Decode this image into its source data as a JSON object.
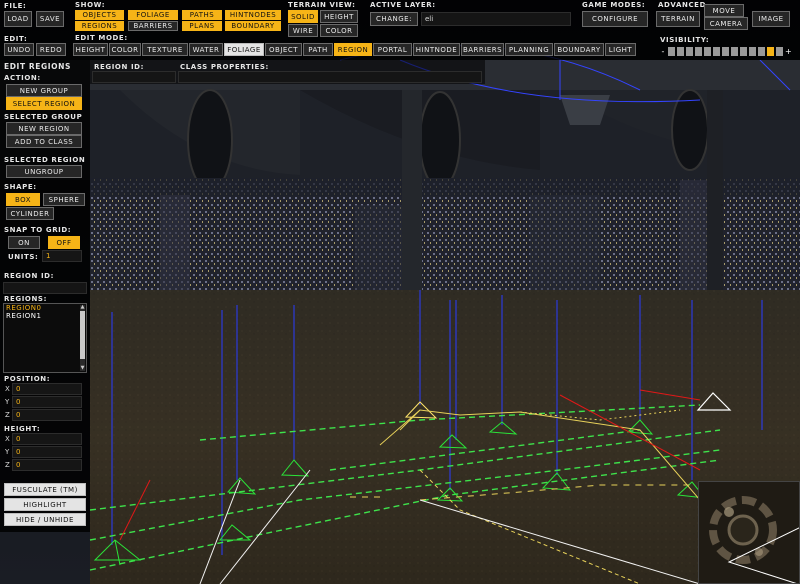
{
  "file": {
    "label": "File:",
    "load": "Load",
    "save": "Save"
  },
  "edit": {
    "label": "Edit:",
    "undo": "Undo",
    "redo": "Redo"
  },
  "show": {
    "label": "Show:",
    "row1": [
      {
        "label": "Objects",
        "on": true
      },
      {
        "label": "Foliage",
        "on": true
      },
      {
        "label": "Paths",
        "on": true
      },
      {
        "label": "HintNodes",
        "on": true
      }
    ],
    "row2": [
      {
        "label": "Regions",
        "on": true
      },
      {
        "label": "Barriers",
        "on": false
      },
      {
        "label": "Plans",
        "on": true
      },
      {
        "label": "Boundary",
        "on": true
      }
    ]
  },
  "terrain_view": {
    "label": "Terrain View:",
    "solid": "Solid",
    "height": "Height",
    "wire": "Wire",
    "color": "Color"
  },
  "active_layer": {
    "label": "Active Layer:",
    "change": "Change:",
    "value": "eli"
  },
  "game_modes": {
    "label": "Game Modes:",
    "configure": "Configure"
  },
  "advanced": {
    "label": "Advanced",
    "terrain": "Terrain",
    "move": "Move",
    "camera": "Camera",
    "image": "Image"
  },
  "edit_mode": {
    "label": "Edit Mode:",
    "modes": [
      "Height",
      "Color",
      "Texture",
      "Water",
      "Foliage",
      "Object",
      "Path",
      "Region",
      "Portal",
      "HintNode",
      "Barriers",
      "Planning",
      "Boundary",
      "Light"
    ],
    "active": "Region",
    "light": "Foliage"
  },
  "visibility": {
    "label": "Visibility:",
    "minus": "-",
    "plus": "+",
    "segments": 13,
    "level": 12
  },
  "header_fields": {
    "region_id": "Region ID:",
    "class_properties": "Class Properties:"
  },
  "sidebar": {
    "title": "Edit Regions",
    "action": "Action:",
    "new_group": "New Group",
    "select_region": "Select Region",
    "selected_group": "Selected Group",
    "new_region": "New Region",
    "add_to_class": "Add To Class",
    "selected_region": "Selected Region",
    "ungroup": "Ungroup",
    "shape": "Shape:",
    "box": "Box",
    "sphere": "Sphere",
    "cylinder": "Cylinder",
    "snap_to_grid": "Snap To Grid:",
    "on": "On",
    "off": "Off",
    "units_label": "Units:",
    "units_value": "1",
    "region_id": "Region ID:",
    "regions_label": "Regions:",
    "regions": [
      "Region0",
      "Region1"
    ],
    "position": "Position:",
    "height": "Height:",
    "axes": [
      "X",
      "Y",
      "Z"
    ],
    "pos_values": [
      "0",
      "0",
      "0"
    ],
    "height_values": [
      "0",
      "0",
      "0"
    ],
    "fusculate": "Fusculate (TM)",
    "highlight": "Highlight",
    "hide_unhide": "Hide / Unhide"
  }
}
